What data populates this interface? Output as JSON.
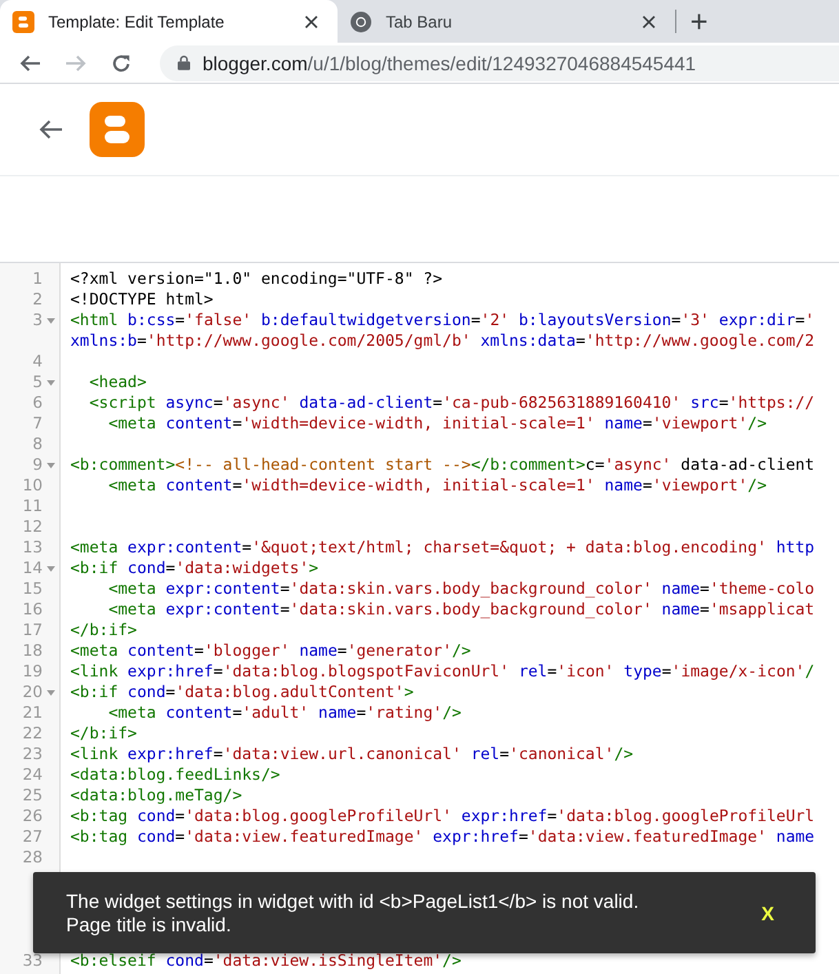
{
  "browser": {
    "tabs": [
      {
        "title": "Template: Edit Template",
        "selected": true,
        "kind": "blogger"
      },
      {
        "title": "Tab Baru",
        "selected": false,
        "kind": "chrome"
      }
    ],
    "new_tab": "+",
    "back": {
      "disabled": false
    },
    "forward": {
      "disabled": true
    },
    "url_host": "blogger.com",
    "url_path": "/u/1/blog/themes/edit/1249327046884545441"
  },
  "editor": {
    "lines": [
      {
        "number": "1",
        "fold": false,
        "tokens": [
          {
            "kind": "plain",
            "text": "<?xml version=\"1.0\" encoding=\"UTF-8\" ?>"
          }
        ]
      },
      {
        "number": "2",
        "fold": false,
        "tokens": [
          {
            "kind": "plain",
            "text": "<!DOCTYPE html>"
          }
        ]
      },
      {
        "number": "3",
        "fold": true,
        "tokens": [
          {
            "kind": "tag",
            "text": "<html"
          },
          {
            "kind": "attr",
            "text": " b:css"
          },
          {
            "kind": "plain",
            "text": "="
          },
          {
            "kind": "string",
            "text": "'false'"
          },
          {
            "kind": "attr",
            "text": " b:defaultwidgetversion"
          },
          {
            "kind": "plain",
            "text": "="
          },
          {
            "kind": "string",
            "text": "'2'"
          },
          {
            "kind": "attr",
            "text": " b:layoutsVersion"
          },
          {
            "kind": "plain",
            "text": "="
          },
          {
            "kind": "string",
            "text": "'3'"
          },
          {
            "kind": "attr",
            "text": " expr:dir"
          },
          {
            "kind": "plain",
            "text": "="
          },
          {
            "kind": "string",
            "text": "'"
          }
        ],
        "continuation": [
          {
            "kind": "attr",
            "text": "xmlns:b"
          },
          {
            "kind": "plain",
            "text": "="
          },
          {
            "kind": "string",
            "text": "'http://www.google.com/2005/gml/b'"
          },
          {
            "kind": "attr",
            "text": " xmlns:data"
          },
          {
            "kind": "plain",
            "text": "="
          },
          {
            "kind": "string",
            "text": "'http://www.google.com/2"
          }
        ]
      },
      {
        "number": "4",
        "fold": false
      },
      {
        "number": "5",
        "fold": true,
        "tokens": [
          {
            "kind": "tag",
            "text": "  <head>"
          }
        ]
      },
      {
        "number": "6",
        "fold": false,
        "tokens": [
          {
            "kind": "tag",
            "text": "  <script"
          },
          {
            "kind": "attr",
            "text": " async"
          },
          {
            "kind": "plain",
            "text": "="
          },
          {
            "kind": "string",
            "text": "'async'"
          },
          {
            "kind": "attr",
            "text": " data-ad-client"
          },
          {
            "kind": "plain",
            "text": "="
          },
          {
            "kind": "string",
            "text": "'ca-pub-6825631889160410'"
          },
          {
            "kind": "attr",
            "text": " src"
          },
          {
            "kind": "plain",
            "text": "="
          },
          {
            "kind": "string",
            "text": "'https://"
          }
        ]
      },
      {
        "number": "7",
        "fold": false,
        "tokens": [
          {
            "kind": "tag",
            "text": "    <meta"
          },
          {
            "kind": "attr",
            "text": " content"
          },
          {
            "kind": "plain",
            "text": "="
          },
          {
            "kind": "string",
            "text": "'width=device-width, initial-scale=1'"
          },
          {
            "kind": "attr",
            "text": " name"
          },
          {
            "kind": "plain",
            "text": "="
          },
          {
            "kind": "string",
            "text": "'viewport'"
          },
          {
            "kind": "tag",
            "text": "/>"
          }
        ]
      },
      {
        "number": "8",
        "fold": false
      },
      {
        "number": "9",
        "fold": true,
        "tokens": [
          {
            "kind": "tag",
            "text": "<b:comment>"
          },
          {
            "kind": "comment",
            "text": "<!-- all-head-content start -->"
          },
          {
            "kind": "tag",
            "text": "</b:comment>"
          },
          {
            "kind": "plain",
            "text": "c="
          },
          {
            "kind": "string",
            "text": "'async'"
          },
          {
            "kind": "plain",
            "text": " data-ad-client"
          }
        ]
      },
      {
        "number": "10",
        "fold": false,
        "tokens": [
          {
            "kind": "tag",
            "text": "    <meta"
          },
          {
            "kind": "attr",
            "text": " content"
          },
          {
            "kind": "plain",
            "text": "="
          },
          {
            "kind": "string",
            "text": "'width=device-width, initial-scale=1'"
          },
          {
            "kind": "attr",
            "text": " name"
          },
          {
            "kind": "plain",
            "text": "="
          },
          {
            "kind": "string",
            "text": "'viewport'"
          },
          {
            "kind": "tag",
            "text": "/>"
          }
        ]
      },
      {
        "number": "11",
        "fold": false
      },
      {
        "number": "12",
        "fold": false
      },
      {
        "number": "13",
        "fold": false,
        "tokens": [
          {
            "kind": "tag",
            "text": "<meta"
          },
          {
            "kind": "attr",
            "text": " expr:content"
          },
          {
            "kind": "plain",
            "text": "="
          },
          {
            "kind": "string",
            "text": "'&quot;text/html; charset=&quot; + data:blog.encoding'"
          },
          {
            "kind": "attr",
            "text": " http"
          }
        ]
      },
      {
        "number": "14",
        "fold": true,
        "tokens": [
          {
            "kind": "tag",
            "text": "<b:if"
          },
          {
            "kind": "attr",
            "text": " cond"
          },
          {
            "kind": "plain",
            "text": "="
          },
          {
            "kind": "string",
            "text": "'data:widgets'"
          },
          {
            "kind": "tag",
            "text": ">"
          }
        ]
      },
      {
        "number": "15",
        "fold": false,
        "tokens": [
          {
            "kind": "tag",
            "text": "    <meta"
          },
          {
            "kind": "attr",
            "text": " expr:content"
          },
          {
            "kind": "plain",
            "text": "="
          },
          {
            "kind": "string",
            "text": "'data:skin.vars.body_background_color'"
          },
          {
            "kind": "attr",
            "text": " name"
          },
          {
            "kind": "plain",
            "text": "="
          },
          {
            "kind": "string",
            "text": "'theme-colo"
          }
        ]
      },
      {
        "number": "16",
        "fold": false,
        "tokens": [
          {
            "kind": "tag",
            "text": "    <meta"
          },
          {
            "kind": "attr",
            "text": " expr:content"
          },
          {
            "kind": "plain",
            "text": "="
          },
          {
            "kind": "string",
            "text": "'data:skin.vars.body_background_color'"
          },
          {
            "kind": "attr",
            "text": " name"
          },
          {
            "kind": "plain",
            "text": "="
          },
          {
            "kind": "string",
            "text": "'msapplicat"
          }
        ]
      },
      {
        "number": "17",
        "fold": false,
        "tokens": [
          {
            "kind": "tag",
            "text": "</b:if>"
          }
        ]
      },
      {
        "number": "18",
        "fold": false,
        "tokens": [
          {
            "kind": "tag",
            "text": "<meta"
          },
          {
            "kind": "attr",
            "text": " content"
          },
          {
            "kind": "plain",
            "text": "="
          },
          {
            "kind": "string",
            "text": "'blogger'"
          },
          {
            "kind": "attr",
            "text": " name"
          },
          {
            "kind": "plain",
            "text": "="
          },
          {
            "kind": "string",
            "text": "'generator'"
          },
          {
            "kind": "tag",
            "text": "/>"
          }
        ]
      },
      {
        "number": "19",
        "fold": false,
        "tokens": [
          {
            "kind": "tag",
            "text": "<link"
          },
          {
            "kind": "attr",
            "text": " expr:href"
          },
          {
            "kind": "plain",
            "text": "="
          },
          {
            "kind": "string",
            "text": "'data:blog.blogspotFaviconUrl'"
          },
          {
            "kind": "attr",
            "text": " rel"
          },
          {
            "kind": "plain",
            "text": "="
          },
          {
            "kind": "string",
            "text": "'icon'"
          },
          {
            "kind": "attr",
            "text": " type"
          },
          {
            "kind": "plain",
            "text": "="
          },
          {
            "kind": "string",
            "text": "'image/x-icon'"
          },
          {
            "kind": "tag",
            "text": "/"
          }
        ]
      },
      {
        "number": "20",
        "fold": true,
        "tokens": [
          {
            "kind": "tag",
            "text": "<b:if"
          },
          {
            "kind": "attr",
            "text": " cond"
          },
          {
            "kind": "plain",
            "text": "="
          },
          {
            "kind": "string",
            "text": "'data:blog.adultContent'"
          },
          {
            "kind": "tag",
            "text": ">"
          }
        ]
      },
      {
        "number": "21",
        "fold": false,
        "tokens": [
          {
            "kind": "tag",
            "text": "    <meta"
          },
          {
            "kind": "attr",
            "text": " content"
          },
          {
            "kind": "plain",
            "text": "="
          },
          {
            "kind": "string",
            "text": "'adult'"
          },
          {
            "kind": "attr",
            "text": " name"
          },
          {
            "kind": "plain",
            "text": "="
          },
          {
            "kind": "string",
            "text": "'rating'"
          },
          {
            "kind": "tag",
            "text": "/>"
          }
        ]
      },
      {
        "number": "22",
        "fold": false,
        "tokens": [
          {
            "kind": "tag",
            "text": "</b:if>"
          }
        ]
      },
      {
        "number": "23",
        "fold": false,
        "tokens": [
          {
            "kind": "tag",
            "text": "<link"
          },
          {
            "kind": "attr",
            "text": " expr:href"
          },
          {
            "kind": "plain",
            "text": "="
          },
          {
            "kind": "string",
            "text": "'data:view.url.canonical'"
          },
          {
            "kind": "attr",
            "text": " rel"
          },
          {
            "kind": "plain",
            "text": "="
          },
          {
            "kind": "string",
            "text": "'canonical'"
          },
          {
            "kind": "tag",
            "text": "/>"
          }
        ]
      },
      {
        "number": "24",
        "fold": false,
        "tokens": [
          {
            "kind": "tag",
            "text": "<data:blog.feedLinks/>"
          }
        ]
      },
      {
        "number": "25",
        "fold": false,
        "tokens": [
          {
            "kind": "tag",
            "text": "<data:blog.meTag/>"
          }
        ]
      },
      {
        "number": "26",
        "fold": false,
        "tokens": [
          {
            "kind": "tag",
            "text": "<b:tag"
          },
          {
            "kind": "attr",
            "text": " cond"
          },
          {
            "kind": "plain",
            "text": "="
          },
          {
            "kind": "string",
            "text": "'data:blog.googleProfileUrl'"
          },
          {
            "kind": "attr",
            "text": " expr:href"
          },
          {
            "kind": "plain",
            "text": "="
          },
          {
            "kind": "string",
            "text": "'data:blog.googleProfileUrl"
          }
        ]
      },
      {
        "number": "27",
        "fold": false,
        "tokens": [
          {
            "kind": "tag",
            "text": "<b:tag"
          },
          {
            "kind": "attr",
            "text": " cond"
          },
          {
            "kind": "plain",
            "text": "="
          },
          {
            "kind": "string",
            "text": "'data:view.featuredImage'"
          },
          {
            "kind": "attr",
            "text": " expr:href"
          },
          {
            "kind": "plain",
            "text": "="
          },
          {
            "kind": "string",
            "text": "'data:view.featuredImage'"
          },
          {
            "kind": "attr",
            "text": " name"
          }
        ]
      },
      {
        "number": "28",
        "fold": false
      }
    ],
    "lines_after": [
      {
        "number": "33",
        "fold": false,
        "tokens": [
          {
            "kind": "tag",
            "text": "<b:elseif"
          },
          {
            "kind": "attr",
            "text": " cond"
          },
          {
            "kind": "plain",
            "text": "="
          },
          {
            "kind": "string",
            "text": "'data:view.isSingleItem'"
          },
          {
            "kind": "tag",
            "text": "/>"
          }
        ]
      }
    ]
  },
  "snackbar": {
    "message": "The widget settings in widget with id <b>PageList1</b> is not valid. Page title is invalid.",
    "dismiss": "X"
  }
}
